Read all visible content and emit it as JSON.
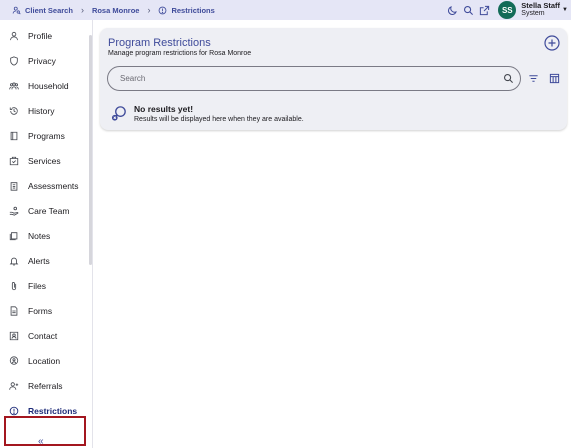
{
  "breadcrumbs": [
    {
      "label": "Client Search",
      "icon": "people-search-icon"
    },
    {
      "label": "Rosa Monroe"
    },
    {
      "label": "Restrictions",
      "icon": "info-circle-icon"
    }
  ],
  "header": {
    "user_initials": "SS",
    "user_name": "Stella Staff",
    "user_role": "System",
    "icons": [
      "moon-icon",
      "search-icon",
      "external-link-icon"
    ]
  },
  "sidebar": {
    "items": [
      {
        "label": "Profile",
        "icon": "person-icon"
      },
      {
        "label": "Privacy",
        "icon": "shield-icon"
      },
      {
        "label": "Household",
        "icon": "group-icon"
      },
      {
        "label": "History",
        "icon": "history-icon"
      },
      {
        "label": "Programs",
        "icon": "book-icon"
      },
      {
        "label": "Services",
        "icon": "services-icon"
      },
      {
        "label": "Assessments",
        "icon": "clipboard-icon"
      },
      {
        "label": "Care Team",
        "icon": "care-team-icon"
      },
      {
        "label": "Notes",
        "icon": "notes-icon"
      },
      {
        "label": "Alerts",
        "icon": "bell-icon"
      },
      {
        "label": "Files",
        "icon": "paperclip-icon"
      },
      {
        "label": "Forms",
        "icon": "document-icon"
      },
      {
        "label": "Contact",
        "icon": "contact-icon"
      },
      {
        "label": "Location",
        "icon": "location-icon"
      },
      {
        "label": "Referrals",
        "icon": "person-add-icon"
      },
      {
        "label": "Restrictions",
        "icon": "info-circle-icon",
        "active": true
      }
    ],
    "collapse_label": "«"
  },
  "main": {
    "title": "Program Restrictions",
    "subtitle": "Manage program restrictions for Rosa Monroe",
    "search_placeholder": "Search",
    "empty_title": "No results yet!",
    "empty_subtitle": "Results will be displayed here when they are available."
  },
  "colors": {
    "accent": "#3f4b9a",
    "avatar": "#136b58",
    "highlight_box": "#a3161f",
    "topbar": "#e5e6f6",
    "card": "#eeeff4"
  }
}
